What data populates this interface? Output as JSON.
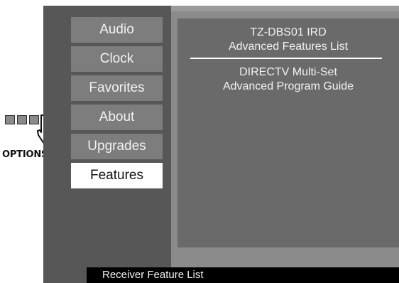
{
  "remote": {
    "icon": "options-hand-pointer-icon",
    "button_label": "OPTIONS"
  },
  "menu": {
    "items": [
      {
        "label": "Audio",
        "selected": false
      },
      {
        "label": "Clock",
        "selected": false
      },
      {
        "label": "Favorites",
        "selected": false
      },
      {
        "label": "About",
        "selected": false
      },
      {
        "label": "Upgrades",
        "selected": false
      },
      {
        "label": "Features",
        "selected": true
      }
    ]
  },
  "panel": {
    "title_line1": "TZ-DBS01 IRD",
    "title_line2": "Advanced Features List",
    "features": [
      "DIRECTV Multi-Set",
      "Advanced Program Guide"
    ]
  },
  "status_bar": {
    "text": "Receiver Feature List"
  },
  "colors": {
    "screen_bg": "#5b5b5b",
    "panel_bg": "#6a6a6a",
    "menu_item_bg": "#7d7d7d",
    "selected_bg": "#ffffff",
    "status_bg": "#000000"
  }
}
